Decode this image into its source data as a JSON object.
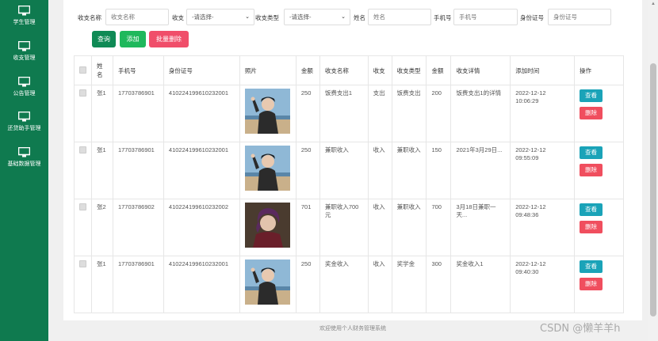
{
  "sidebar": {
    "items": [
      {
        "label": "学生管理",
        "icon": "monitor-icon"
      },
      {
        "label": "收支管理",
        "icon": "monitor-icon"
      },
      {
        "label": "公告管理",
        "icon": "monitor-icon"
      },
      {
        "label": "还贷助手管理",
        "icon": "monitor-icon"
      },
      {
        "label": "基础数据管理",
        "icon": "monitor-icon"
      }
    ]
  },
  "search": {
    "name_label": "收支名称",
    "name_placeholder": "收支名称",
    "type_label": "收支",
    "type_value": "-请选择-",
    "category_label": "收支类型",
    "category_value": "-请选择-",
    "person_label": "姓名",
    "person_placeholder": "姓名",
    "phone_label": "手机号",
    "phone_placeholder": "手机号",
    "id_label": "身份证号",
    "id_placeholder": "身份证号"
  },
  "buttons": {
    "query": "查询",
    "add": "添加",
    "batch_delete": "批量删除"
  },
  "table": {
    "headers": [
      "姓名",
      "手机号",
      "身份证号",
      "照片",
      "金额",
      "收支名称",
      "收支",
      "收支类型",
      "金额",
      "收支详情",
      "添加时间",
      "操作"
    ],
    "rows": [
      {
        "name": "张1",
        "phone": "17703786901",
        "id_no": "410224199610232001",
        "photo": "person-photo-1",
        "amount": "250",
        "item_name": "饭费支出1",
        "direction": "支出",
        "category": "饭费支出",
        "money": "200",
        "detail": "饭费支出1的详情",
        "time": "2022-12-12 10:06:29",
        "view": "查看",
        "delete": "删除"
      },
      {
        "name": "张1",
        "phone": "17703786901",
        "id_no": "410224199610232001",
        "photo": "person-photo-1",
        "amount": "250",
        "item_name": "兼职收入",
        "direction": "收入",
        "category": "兼职收入",
        "money": "150",
        "detail": "2021年3月29日...",
        "time": "2022-12-12 09:55:09",
        "view": "查看",
        "delete": "删除"
      },
      {
        "name": "张2",
        "phone": "17703786902",
        "id_no": "410224199610232002",
        "photo": "person-photo-2",
        "amount": "701",
        "item_name": "兼职收入700元",
        "direction": "收入",
        "category": "兼职收入",
        "money": "700",
        "detail": "3月18日兼职一天...",
        "time": "2022-12-12 09:48:36",
        "view": "查看",
        "delete": "删除"
      },
      {
        "name": "张1",
        "phone": "17703786901",
        "id_no": "410224199610232001",
        "photo": "person-photo-1",
        "amount": "250",
        "item_name": "奖金收入",
        "direction": "收入",
        "category": "奖学金",
        "money": "300",
        "detail": "奖金收入1",
        "time": "2022-12-12 09:40:30",
        "view": "查看",
        "delete": "删除"
      }
    ]
  },
  "footer": {
    "text": "欢迎使用个人财务管理系统"
  },
  "watermark": {
    "text": "CSDN @懒羊羊h"
  },
  "colors": {
    "sidebar": "#0f7a4f",
    "query": "#0f8a55",
    "add": "#1fb85c",
    "batch_delete": "#f04e6a",
    "view": "#1aa3b8",
    "delete": "#f04e5e"
  }
}
